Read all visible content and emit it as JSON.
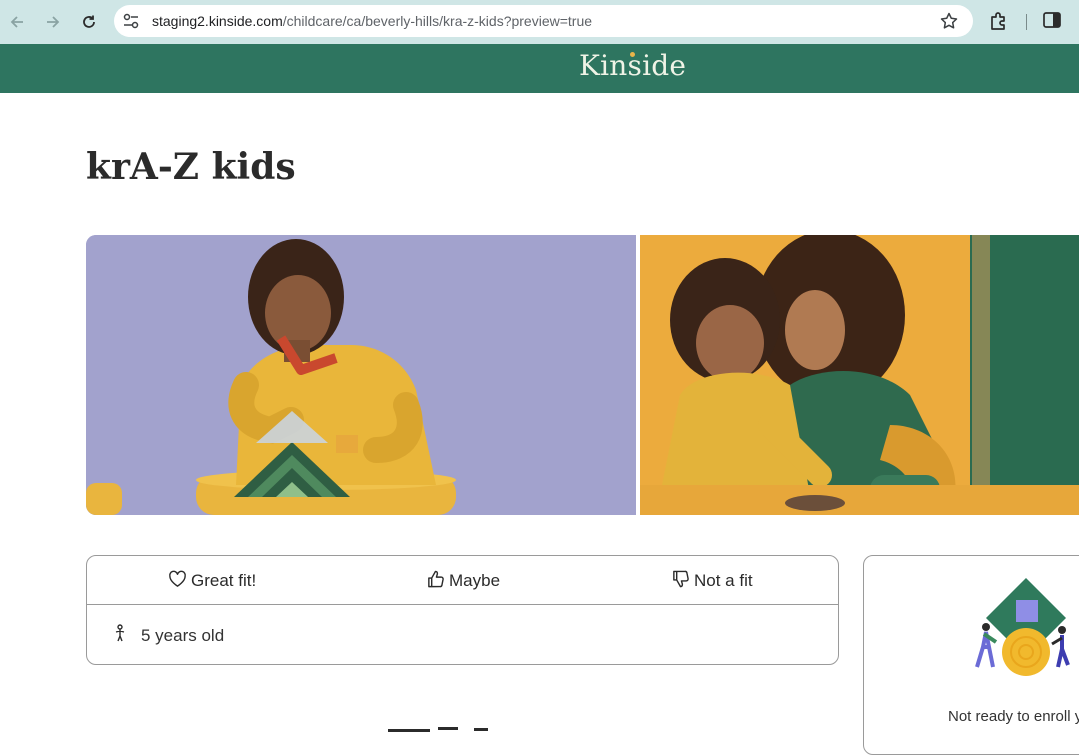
{
  "browser": {
    "url_host": "staging2.kinside.com",
    "url_path": "/childcare/ca/beverly-hills/kra-z-kids?preview=true",
    "icons": [
      "back-arrow-icon",
      "forward-arrow-icon",
      "reload-icon",
      "site-settings-icon",
      "star-icon",
      "extensions-icon",
      "side-panel-icon"
    ]
  },
  "header": {
    "logo": "Kinside",
    "bg_color": "#2e7560"
  },
  "page": {
    "title": "krA-Z kids"
  },
  "fit": {
    "great_label": "Great fit!",
    "maybe_label": "Maybe",
    "not_fit_label": "Not a fit",
    "age_label": "5 years old"
  },
  "enroll": {
    "text": "Not ready to enroll y"
  }
}
